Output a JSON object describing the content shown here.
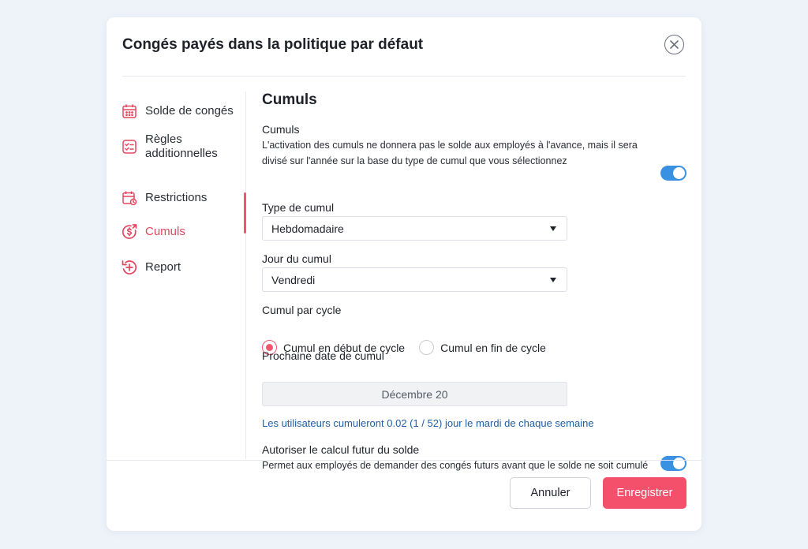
{
  "modal": {
    "title": "Congés payés dans la politique par défaut"
  },
  "sidebar": {
    "items": [
      {
        "label": "Solde de congés",
        "icon": "calendar-icon",
        "active": false
      },
      {
        "label": "Règles\nadditionnelles",
        "icon": "checklist-icon",
        "active": false
      },
      {
        "label": "Restrictions",
        "icon": "calendar-restriction-icon",
        "active": false
      },
      {
        "label": "Cumuls",
        "icon": "dollar-cycle-icon",
        "active": true
      },
      {
        "label": "Report",
        "icon": "plus-cycle-icon",
        "active": false
      }
    ]
  },
  "content": {
    "section_title": "Cumuls",
    "cumuls_label": "Cumuls",
    "cumuls_description": "L'activation des cumuls ne donnera pas le solde aux employés à l'avance, mais il sera divisé sur l'année sur la base du type de cumul que vous sélectionnez",
    "cumuls_enabled": true,
    "type_label": "Type de cumul",
    "type_value": "Hebdomadaire",
    "day_label": "Jour du cumul",
    "day_value": "Vendredi",
    "cycle_label": "Cumul par cycle",
    "cycle_options": [
      "Cumul en début de cycle",
      "Cumul en fin de cycle"
    ],
    "cycle_selected": 0,
    "next_date_label": "Prochaine date de cumul",
    "next_date_value": "Décembre 20",
    "info_text": "Les utilisateurs cumuleront 0.02 (1 / 52) jour le mardi de chaque semaine",
    "future_label": "Autoriser le calcul futur du solde",
    "future_description": "Permet aux employés de demander des congés futurs avant que le solde ne soit cumulé",
    "future_enabled": true
  },
  "footer": {
    "cancel_label": "Annuler",
    "save_label": "Enregistrer"
  },
  "colors": {
    "accent": "#f0566f",
    "toggle": "#3a91e2",
    "link": "#1f5fa8"
  }
}
